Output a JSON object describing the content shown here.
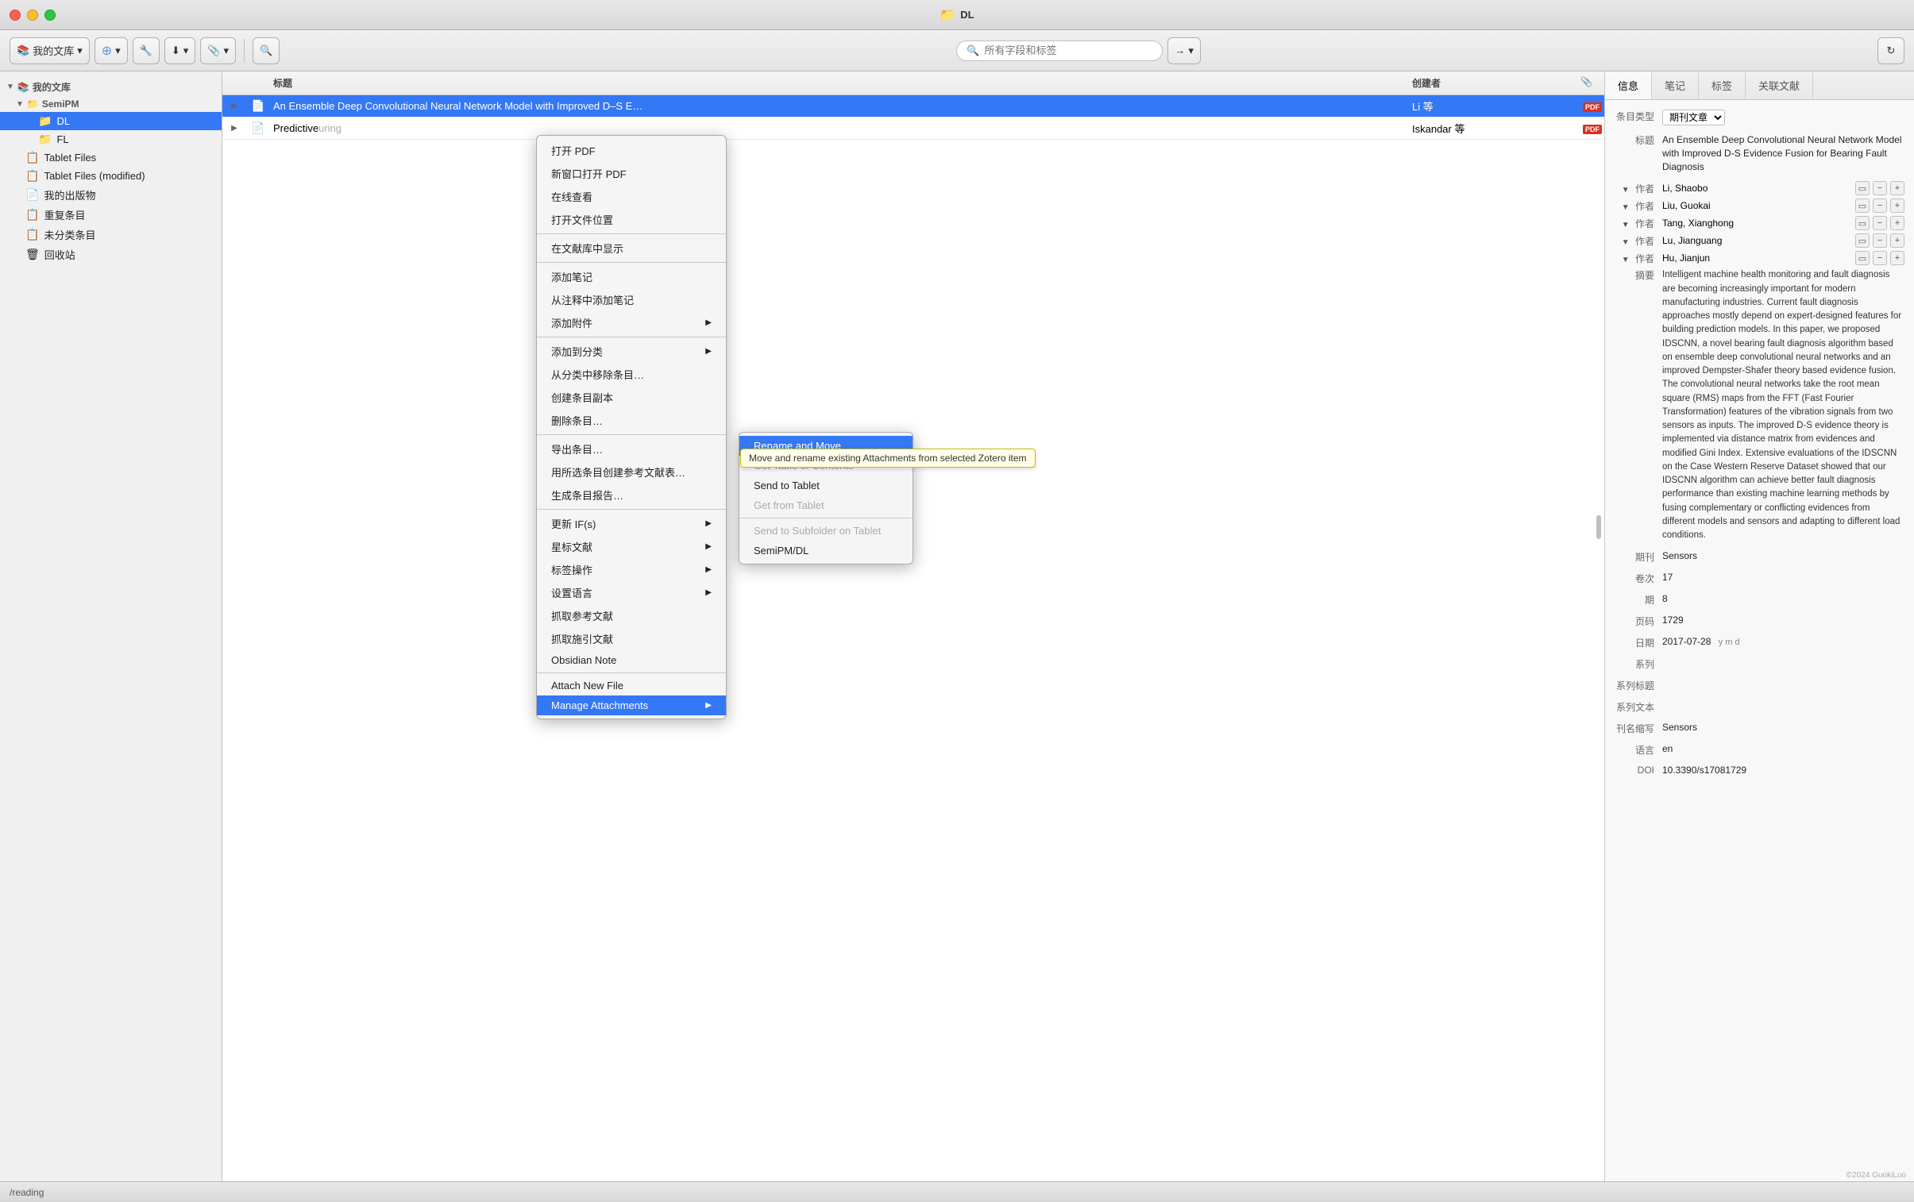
{
  "titlebar": {
    "title": "DL",
    "folder_icon": "📁"
  },
  "toolbar": {
    "btn_library": "我的文库",
    "btn_new": "+",
    "search_placeholder": "所有字段和标签",
    "sync_icon": "↻"
  },
  "sidebar": {
    "my_library": "我的文库",
    "sections": [
      {
        "id": "semipm",
        "label": "SemiPM",
        "indent": 1,
        "icon": "▼",
        "type": "group"
      },
      {
        "id": "dl",
        "label": "DL",
        "indent": 2,
        "icon": "📁",
        "type": "folder",
        "selected": true
      },
      {
        "id": "fl",
        "label": "FL",
        "indent": 2,
        "icon": "📁",
        "type": "folder"
      },
      {
        "id": "tablet-files",
        "label": "Tablet Files",
        "indent": 1,
        "icon": "📋",
        "type": "smart"
      },
      {
        "id": "tablet-files-mod",
        "label": "Tablet Files (modified)",
        "indent": 1,
        "icon": "📋",
        "type": "smart"
      },
      {
        "id": "my-pubs",
        "label": "我的出版物",
        "indent": 1,
        "icon": "📄",
        "type": "smart"
      },
      {
        "id": "duplicates",
        "label": "重复条目",
        "indent": 1,
        "icon": "📋",
        "type": "smart"
      },
      {
        "id": "unsorted",
        "label": "未分类条目",
        "indent": 1,
        "icon": "📋",
        "type": "smart"
      },
      {
        "id": "trash",
        "label": "回收站",
        "indent": 1,
        "icon": "🗑",
        "type": "trash"
      }
    ]
  },
  "table": {
    "headers": {
      "expand": "",
      "type": "",
      "title": "标题",
      "creator": "创建者",
      "attach": "📎"
    },
    "rows": [
      {
        "id": "row1",
        "expand": "▶",
        "type": "doc",
        "title": "An Ensemble Deep Convolutional Neural Network Model with Improved D–S E…",
        "creator": "Li 等",
        "has_pdf": true,
        "highlighted": true
      },
      {
        "id": "row2",
        "expand": "▶",
        "type": "doc",
        "title": "Predictive…",
        "creator": "Iskandar 等",
        "has_pdf": true,
        "highlighted": false,
        "sub": "uring"
      }
    ]
  },
  "context_menu": {
    "items": [
      {
        "id": "open-pdf",
        "label": "打开 PDF",
        "has_arrow": false,
        "disabled": false
      },
      {
        "id": "open-pdf-new",
        "label": "新窗口打开 PDF",
        "has_arrow": false,
        "disabled": false
      },
      {
        "id": "view-online",
        "label": "在线查看",
        "has_arrow": false,
        "disabled": false
      },
      {
        "id": "open-location",
        "label": "打开文件位置",
        "has_arrow": false,
        "disabled": false
      },
      {
        "id": "sep1",
        "type": "separator"
      },
      {
        "id": "show-in-library",
        "label": "在文献库中显示",
        "has_arrow": false,
        "disabled": false
      },
      {
        "id": "sep2",
        "type": "separator"
      },
      {
        "id": "add-note",
        "label": "添加笔记",
        "has_arrow": false,
        "disabled": false
      },
      {
        "id": "add-note-from-annot",
        "label": "从注释中添加笔记",
        "has_arrow": false,
        "disabled": false
      },
      {
        "id": "add-attach",
        "label": "添加附件",
        "has_arrow": true,
        "disabled": false
      },
      {
        "id": "sep3",
        "type": "separator"
      },
      {
        "id": "add-to-collection",
        "label": "添加到分类",
        "has_arrow": true,
        "disabled": false
      },
      {
        "id": "remove-from-collection",
        "label": "从分类中移除条目…",
        "has_arrow": false,
        "disabled": false
      },
      {
        "id": "dup-item",
        "label": "创建条目副本",
        "has_arrow": false,
        "disabled": false
      },
      {
        "id": "delete-item",
        "label": "删除条目…",
        "has_arrow": false,
        "disabled": false
      },
      {
        "id": "sep4",
        "type": "separator"
      },
      {
        "id": "export-item",
        "label": "导出条目…",
        "has_arrow": false,
        "disabled": false
      },
      {
        "id": "create-bib",
        "label": "用所选条目创建参考文献表…",
        "has_arrow": false,
        "disabled": false
      },
      {
        "id": "gen-report",
        "label": "生成条目报告…",
        "has_arrow": false,
        "disabled": false
      },
      {
        "id": "sep5",
        "type": "separator"
      },
      {
        "id": "update-if",
        "label": "更新 IF(s)",
        "has_arrow": true,
        "disabled": false
      },
      {
        "id": "star-lit",
        "label": "星标文献",
        "has_arrow": true,
        "disabled": false
      },
      {
        "id": "tag-ops",
        "label": "标签操作",
        "has_arrow": true,
        "disabled": false
      },
      {
        "id": "set-lang",
        "label": "设置语言",
        "has_arrow": true,
        "disabled": false
      },
      {
        "id": "fetch-refs",
        "label": "抓取参考文献",
        "has_arrow": false,
        "disabled": false
      },
      {
        "id": "fetch-cite",
        "label": "抓取施引文献",
        "has_arrow": false,
        "disabled": false
      },
      {
        "id": "obsidian-note",
        "label": "Obsidian Note",
        "has_arrow": false,
        "disabled": false
      },
      {
        "id": "sep6",
        "type": "separator"
      },
      {
        "id": "attach-new-file",
        "label": "Attach New File",
        "has_arrow": false,
        "disabled": false
      },
      {
        "id": "manage-attachments",
        "label": "Manage Attachments",
        "has_arrow": true,
        "disabled": false,
        "highlighted": true
      }
    ]
  },
  "manage_submenu": {
    "items": [
      {
        "id": "rename-move",
        "label": "Rename and Move",
        "highlighted": true
      },
      {
        "id": "get-table-of-contents",
        "label": "Get Table of Contents",
        "disabled": false
      },
      {
        "id": "send-to-tablet",
        "label": "Send to Tablet",
        "disabled": false
      },
      {
        "id": "get-from-tablet",
        "label": "Get from Tablet",
        "disabled": true
      },
      {
        "id": "sep-tablet",
        "type": "separator"
      },
      {
        "id": "send-to-subfolder",
        "label": "Send to Subfolder on Tablet",
        "disabled": true
      },
      {
        "id": "subfolder-path",
        "label": "SemiPM/DL",
        "disabled": false
      }
    ]
  },
  "tooltip": {
    "text": "Move and rename existing Attachments from selected Zotero item"
  },
  "right_panel": {
    "tabs": [
      {
        "id": "info",
        "label": "信息",
        "active": true
      },
      {
        "id": "notes",
        "label": "笔记"
      },
      {
        "id": "tags",
        "label": "标签"
      },
      {
        "id": "related",
        "label": "关联文献"
      }
    ],
    "item_type_label": "条目类型",
    "item_type_value": "期刊文章",
    "title_label": "标题",
    "title_value": "An Ensemble Deep Convolutional Neural Network Model with Improved D-S Evidence Fusion for Bearing Fault Diagnosis",
    "authors": [
      {
        "role": "作者",
        "name": "Li, Shaobo"
      },
      {
        "role": "作者",
        "name": "Liu, Guokai"
      },
      {
        "role": "作者",
        "name": "Tang, Xianghong"
      },
      {
        "role": "作者",
        "name": "Lu, Jianguang"
      },
      {
        "role": "作者",
        "name": "Hu, Jianjun"
      }
    ],
    "abstract_label": "摘要",
    "abstract": "Intelligent machine health monitoring and fault diagnosis are becoming increasingly important for modern manufacturing industries. Current fault diagnosis approaches mostly depend on expert-designed features for building prediction models. In this paper, we proposed IDSCNN, a novel bearing fault diagnosis algorithm based on ensemble deep convolutional neural networks and an improved Dempster-Shafer theory based evidence fusion. The convolutional neural networks take the root mean square (RMS) maps from the FFT (Fast Fourier Transformation) features of the vibration signals from two sensors as inputs. The improved D-S evidence theory is implemented via distance matrix from evidences and modified Gini Index. Extensive evaluations of the IDSCNN on the Case Western Reserve Dataset showed that our IDSCNN algorithm can achieve better fault diagnosis performance than existing machine learning methods by fusing complementary or conflicting evidences from different models and sensors and adapting to different load conditions.",
    "journal_label": "期刊",
    "journal_value": "Sensors",
    "volume_label": "卷次",
    "volume_value": "17",
    "issue_label": "期",
    "issue_value": "8",
    "pages_label": "页码",
    "pages_value": "1729",
    "date_label": "日期",
    "date_value": "2017-07-28",
    "date_suffix": "y m d",
    "series_label": "系列",
    "series_value": "",
    "series_title_label": "系列标题",
    "series_title_value": "",
    "series_text_label": "系列文本",
    "series_text_value": "",
    "journal_abbr_label": "刊名缩写",
    "journal_abbr_value": "Sensors",
    "language_label": "语言",
    "language_value": "en",
    "doi_label": "DOI",
    "doi_value": "10.3390/s17081729"
  },
  "statusbar": {
    "path": "/reading"
  },
  "watermark": "©2024 GuokiLuo"
}
